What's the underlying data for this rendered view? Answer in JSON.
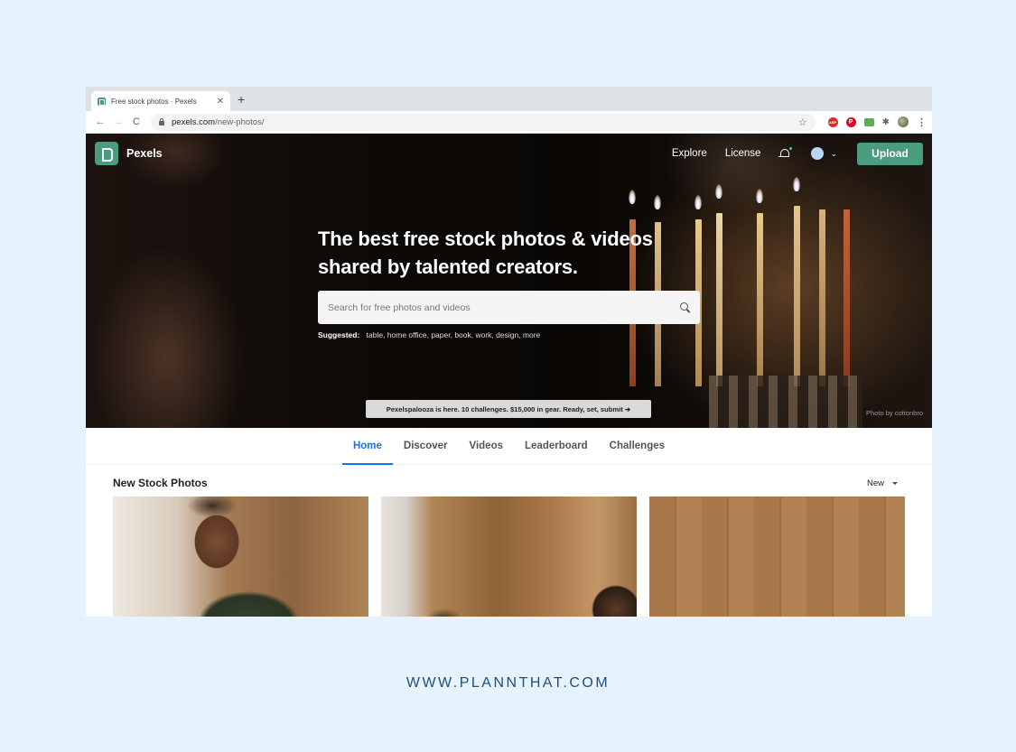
{
  "browser": {
    "tab_title": "Free stock photos · Pexels",
    "tab_close": "✕",
    "new_tab": "+",
    "back": "←",
    "forward": "→",
    "reload": "C",
    "url_host": "pexels.com",
    "url_path": "/new-photos/",
    "bookmark": "☆",
    "extensions": {
      "adblock": "ABP",
      "pinterest": "P",
      "puzzle": "✱"
    },
    "menu": "⋮"
  },
  "site": {
    "brand": "Pexels",
    "nav": [
      "Explore",
      "License"
    ],
    "upload_label": "Upload",
    "chevron": "⌄",
    "accent": "#4a9c7f"
  },
  "hero": {
    "title_line1": "The best free stock photos & videos",
    "title_line2": "shared by talented creators.",
    "search_placeholder": "Search for free photos and videos",
    "suggested_label": "Suggested:",
    "suggested_terms": "table, home office, paper, book, work, design, more",
    "promo": "Pexelspalooza is here. 10 challenges. $15,000 in gear. Ready, set, submit ➔",
    "credit": "Photo by cottonbro"
  },
  "tabs": [
    {
      "label": "Home",
      "active": true
    },
    {
      "label": "Discover",
      "active": false
    },
    {
      "label": "Videos",
      "active": false
    },
    {
      "label": "Leaderboard",
      "active": false
    },
    {
      "label": "Challenges",
      "active": false
    }
  ],
  "section": {
    "title": "New Stock Photos",
    "sort_label": "New"
  },
  "footer": {
    "brand_url": "WWW.PLANNTHAT.COM"
  }
}
